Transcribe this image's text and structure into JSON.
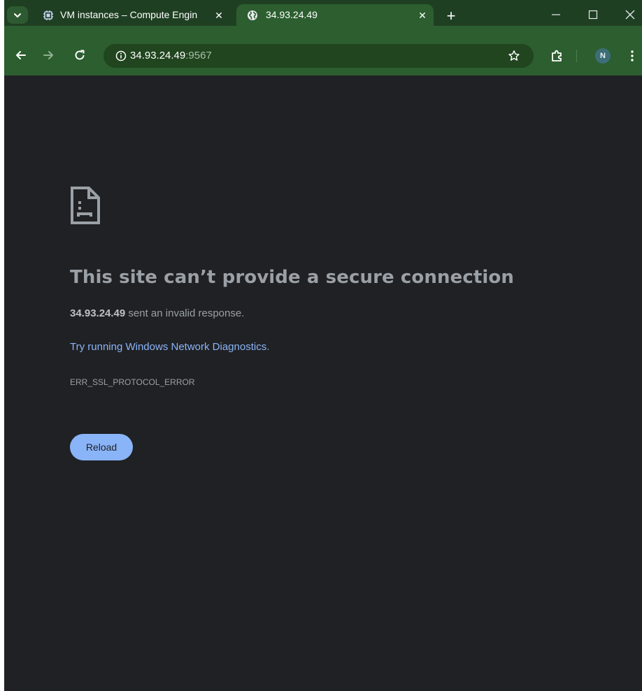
{
  "browser": {
    "tabs": [
      {
        "title": "VM instances – Compute Engin",
        "favicon": "compute-engine-icon",
        "close_glyph": "✕",
        "active": false
      },
      {
        "title": "34.93.24.49",
        "favicon": "globe-icon",
        "close_glyph": "✕",
        "active": true
      }
    ],
    "new_tab_glyph": "+",
    "window_controls": {
      "minimize": "—",
      "maximize": "☐",
      "close": "✕"
    },
    "address_bar": {
      "host": "34.93.24.49",
      "port": ":9567"
    },
    "profile_initial": "N",
    "colors": {
      "frame": "#1f3f22",
      "toolbar": "#2c5e2f",
      "omnibox": "#20451f"
    }
  },
  "error_page": {
    "title": "This site can’t provide a secure connection",
    "host": "34.93.24.49",
    "description_suffix": " sent an invalid response.",
    "diagnostics_link": "Try running Windows Network Diagnostics",
    "diagnostics_suffix": ".",
    "error_code": "ERR_SSL_PROTOCOL_ERROR",
    "reload_label": "Reload",
    "colors": {
      "background": "#202124",
      "text": "#9aa0a6",
      "link": "#8ab4f8",
      "button": "#8ab4f8"
    }
  }
}
